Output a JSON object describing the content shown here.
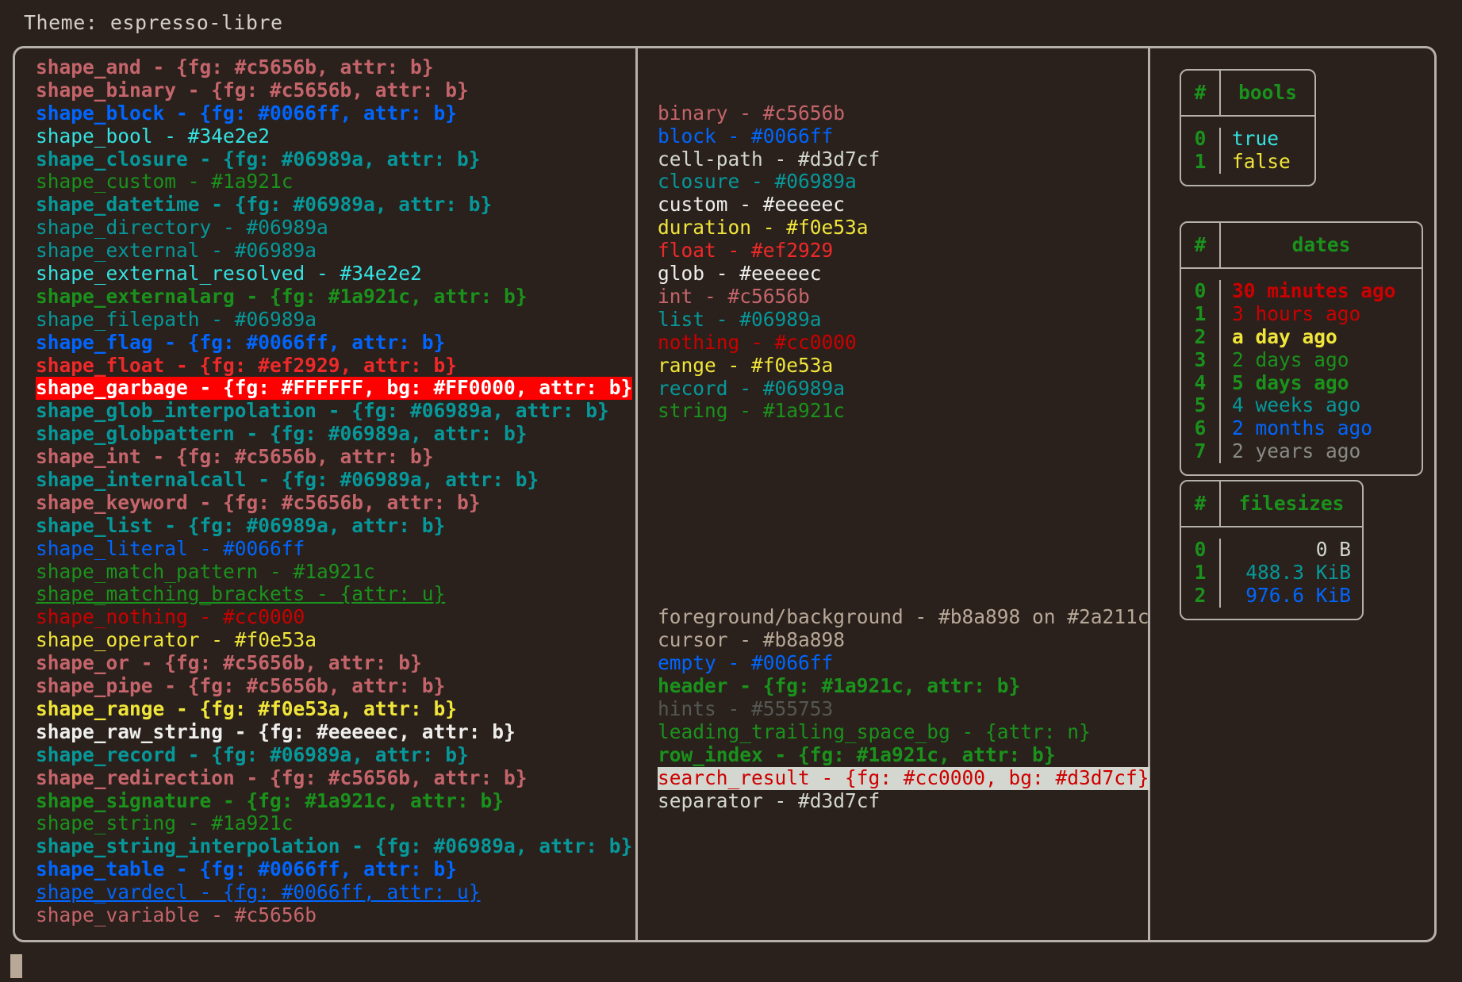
{
  "header": {
    "theme_label": "Theme: espresso-libre"
  },
  "palette": {
    "background": "#2a211c",
    "foreground": "#b8a898",
    "border": "#b5b0a8",
    "red": "#cc0000",
    "bright_red": "#ef2929",
    "green": "#1a921c",
    "teal": "#06989a",
    "cyan": "#34e2e2",
    "yellow": "#f0e53a",
    "blue": "#0066ff",
    "pink": "#c5656b",
    "white": "#eeeeec",
    "light_grey": "#d3d7cf",
    "dark_grey": "#555753"
  },
  "shapes_column": [
    {
      "text": "shape_and - {fg: #c5656b, attr: b}",
      "fg": "#c5656b",
      "bold": true
    },
    {
      "text": "shape_binary - {fg: #c5656b, attr: b}",
      "fg": "#c5656b",
      "bold": true
    },
    {
      "text": "shape_block - {fg: #0066ff, attr: b}",
      "fg": "#0066ff",
      "bold": true
    },
    {
      "text": "shape_bool - #34e2e2",
      "fg": "#34e2e2",
      "bold": false
    },
    {
      "text": "shape_closure - {fg: #06989a, attr: b}",
      "fg": "#06989a",
      "bold": true
    },
    {
      "text": "shape_custom - #1a921c",
      "fg": "#1a921c",
      "bold": false
    },
    {
      "text": "shape_datetime - {fg: #06989a, attr: b}",
      "fg": "#06989a",
      "bold": true
    },
    {
      "text": "shape_directory - #06989a",
      "fg": "#06989a",
      "bold": false
    },
    {
      "text": "shape_external - #06989a",
      "fg": "#06989a",
      "bold": false
    },
    {
      "text": "shape_external_resolved - #34e2e2",
      "fg": "#34e2e2",
      "bold": false
    },
    {
      "text": "shape_externalarg - {fg: #1a921c, attr: b}",
      "fg": "#1a921c",
      "bold": true
    },
    {
      "text": "shape_filepath - #06989a",
      "fg": "#06989a",
      "bold": false
    },
    {
      "text": "shape_flag - {fg: #0066ff, attr: b}",
      "fg": "#0066ff",
      "bold": true
    },
    {
      "text": "shape_float - {fg: #ef2929, attr: b}",
      "fg": "#ef2929",
      "bold": true
    },
    {
      "text": "shape_garbage - {fg: #FFFFFF, bg: #FF0000, attr: b}",
      "fg": "#FFFFFF",
      "bg": "#FF0000",
      "bold": true
    },
    {
      "text": "shape_glob_interpolation - {fg: #06989a, attr: b}",
      "fg": "#06989a",
      "bold": true
    },
    {
      "text": "shape_globpattern - {fg: #06989a, attr: b}",
      "fg": "#06989a",
      "bold": true
    },
    {
      "text": "shape_int - {fg: #c5656b, attr: b}",
      "fg": "#c5656b",
      "bold": true
    },
    {
      "text": "shape_internalcall - {fg: #06989a, attr: b}",
      "fg": "#06989a",
      "bold": true
    },
    {
      "text": "shape_keyword - {fg: #c5656b, attr: b}",
      "fg": "#c5656b",
      "bold": true
    },
    {
      "text": "shape_list - {fg: #06989a, attr: b}",
      "fg": "#06989a",
      "bold": true
    },
    {
      "text": "shape_literal - #0066ff",
      "fg": "#0066ff",
      "bold": false
    },
    {
      "text": "shape_match_pattern - #1a921c",
      "fg": "#1a921c",
      "bold": false
    },
    {
      "text": "shape_matching_brackets - {attr: u}",
      "fg": "#1a921c",
      "bold": false,
      "underline": true
    },
    {
      "text": "shape_nothing - #cc0000",
      "fg": "#cc0000",
      "bold": false
    },
    {
      "text": "shape_operator - #f0e53a",
      "fg": "#f0e53a",
      "bold": false
    },
    {
      "text": "shape_or - {fg: #c5656b, attr: b}",
      "fg": "#c5656b",
      "bold": true
    },
    {
      "text": "shape_pipe - {fg: #c5656b, attr: b}",
      "fg": "#c5656b",
      "bold": true
    },
    {
      "text": "shape_range - {fg: #f0e53a, attr: b}",
      "fg": "#f0e53a",
      "bold": true
    },
    {
      "text": "shape_raw_string - {fg: #eeeeec, attr: b}",
      "fg": "#eeeeec",
      "bold": true
    },
    {
      "text": "shape_record - {fg: #06989a, attr: b}",
      "fg": "#06989a",
      "bold": true
    },
    {
      "text": "shape_redirection - {fg: #c5656b, attr: b}",
      "fg": "#c5656b",
      "bold": true
    },
    {
      "text": "shape_signature - {fg: #1a921c, attr: b}",
      "fg": "#1a921c",
      "bold": true
    },
    {
      "text": "shape_string - #1a921c",
      "fg": "#1a921c",
      "bold": false
    },
    {
      "text": "shape_string_interpolation - {fg: #06989a, attr: b}",
      "fg": "#06989a",
      "bold": true
    },
    {
      "text": "shape_table - {fg: #0066ff, attr: b}",
      "fg": "#0066ff",
      "bold": true
    },
    {
      "text": "shape_vardecl - {fg: #0066ff, attr: u}",
      "fg": "#0066ff",
      "bold": false,
      "underline": true
    },
    {
      "text": "shape_variable - #c5656b",
      "fg": "#c5656b",
      "bold": false
    }
  ],
  "types_column": [
    {
      "text": "binary - #c5656b",
      "fg": "#c5656b",
      "bold": false
    },
    {
      "text": "block - #0066ff",
      "fg": "#0066ff",
      "bold": false
    },
    {
      "text": "cell-path - #d3d7cf",
      "fg": "#d3d7cf",
      "bold": false
    },
    {
      "text": "closure - #06989a",
      "fg": "#06989a",
      "bold": false
    },
    {
      "text": "custom - #eeeeec",
      "fg": "#eeeeec",
      "bold": false
    },
    {
      "text": "duration - #f0e53a",
      "fg": "#f0e53a",
      "bold": false
    },
    {
      "text": "float - #ef2929",
      "fg": "#ef2929",
      "bold": false
    },
    {
      "text": "glob - #eeeeec",
      "fg": "#eeeeec",
      "bold": false
    },
    {
      "text": "int - #c5656b",
      "fg": "#c5656b",
      "bold": false
    },
    {
      "text": "list - #06989a",
      "fg": "#06989a",
      "bold": false
    },
    {
      "text": "nothing - #cc0000",
      "fg": "#cc0000",
      "bold": false
    },
    {
      "text": "range - #f0e53a",
      "fg": "#f0e53a",
      "bold": false
    },
    {
      "text": "record - #06989a",
      "fg": "#06989a",
      "bold": false
    },
    {
      "text": "string - #1a921c",
      "fg": "#1a921c",
      "bold": false
    }
  ],
  "ui_column": [
    {
      "text": "foreground/background - #b8a898 on #2a211c",
      "fg": "#b8a898",
      "bold": false
    },
    {
      "text": "cursor - #b8a898",
      "fg": "#b8a898",
      "bold": false
    },
    {
      "text": "empty - #0066ff",
      "fg": "#0066ff",
      "bold": false
    },
    {
      "text": "header - {fg: #1a921c, attr: b}",
      "fg": "#1a921c",
      "bold": true
    },
    {
      "text": "hints - #555753",
      "fg": "#555753",
      "bold": false
    },
    {
      "text": "leading_trailing_space_bg - {attr: n}",
      "fg": "#1a921c",
      "bold": false
    },
    {
      "text": "row_index - {fg: #1a921c, attr: b}",
      "fg": "#1a921c",
      "bold": true
    },
    {
      "text": "search_result - {fg: #cc0000, bg: #d3d7cf}",
      "fg": "#cc0000",
      "bg": "#d3d7cf",
      "bold": false
    },
    {
      "text": "separator - #d3d7cf",
      "fg": "#d3d7cf",
      "bold": false
    }
  ],
  "tables": {
    "bools": {
      "index_header": "#",
      "value_header": "bools",
      "rows": [
        {
          "index": "0",
          "value": "true",
          "fg": "#34e2e2",
          "bold": false
        },
        {
          "index": "1",
          "value": "false",
          "fg": "#f0e53a",
          "bold": false
        }
      ]
    },
    "dates": {
      "index_header": "#",
      "value_header": "dates",
      "rows": [
        {
          "index": "0",
          "value": "30 minutes ago",
          "fg": "#cc0000",
          "bold": true
        },
        {
          "index": "1",
          "value": "3 hours ago",
          "fg": "#cc0000",
          "bold": false
        },
        {
          "index": "2",
          "value": "a day ago",
          "fg": "#f0e53a",
          "bold": true
        },
        {
          "index": "3",
          "value": "2 days ago",
          "fg": "#1a921c",
          "bold": false
        },
        {
          "index": "4",
          "value": "5 days ago",
          "fg": "#1a921c",
          "bold": true
        },
        {
          "index": "5",
          "value": "4 weeks ago",
          "fg": "#06989a",
          "bold": false
        },
        {
          "index": "6",
          "value": "2 months ago",
          "fg": "#0066ff",
          "bold": false
        },
        {
          "index": "7",
          "value": "2 years ago",
          "fg": "#888a85",
          "bold": false
        }
      ]
    },
    "filesizes": {
      "index_header": "#",
      "value_header": "filesizes",
      "rows": [
        {
          "index": "0",
          "value": "0 B",
          "fg": "#d3d7cf",
          "bold": false
        },
        {
          "index": "1",
          "value": "488.3 KiB",
          "fg": "#06989a",
          "bold": false
        },
        {
          "index": "2",
          "value": "976.6 KiB",
          "fg": "#0066ff",
          "bold": false
        }
      ]
    }
  }
}
